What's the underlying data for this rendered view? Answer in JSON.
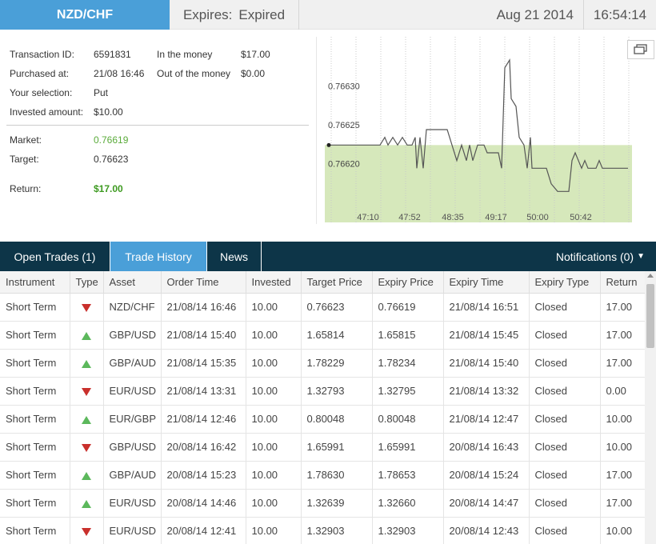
{
  "header": {
    "asset": "NZD/CHF",
    "expires_label": "Expires:",
    "expires_value": "Expired",
    "date": "Aug 21 2014",
    "time": "16:54:14"
  },
  "info": {
    "transaction_id_label": "Transaction ID:",
    "transaction_id": "6591831",
    "purchased_label": "Purchased at:",
    "purchased": "21/08 16:46",
    "selection_label": "Your selection:",
    "selection": "Put",
    "invested_label": "Invested amount:",
    "invested": "$10.00",
    "in_money_label": "In the money",
    "in_money": "$17.00",
    "out_money_label": "Out of the money",
    "out_money": "$0.00",
    "market_label": "Market:",
    "market": "0.76619",
    "target_label": "Target:",
    "target": "0.76623",
    "return_label": "Return:",
    "return": "$17.00"
  },
  "chart_data": {
    "type": "line",
    "y_tick_labels": [
      "0.76630",
      "0.76625",
      "0.76620"
    ],
    "x_tick_labels": [
      "47:10",
      "47:52",
      "48:35",
      "49:17",
      "50:00",
      "50:42"
    ],
    "target_level": 0.76623,
    "ylim": [
      0.76613,
      0.76637
    ],
    "highlight_color": "#d6e8bb",
    "line_color": "#555555",
    "points": [
      [
        0,
        0.76623
      ],
      [
        64,
        0.76623
      ],
      [
        70,
        0.76624
      ],
      [
        74,
        0.76623
      ],
      [
        80,
        0.76624
      ],
      [
        86,
        0.76623
      ],
      [
        92,
        0.76624
      ],
      [
        98,
        0.76623
      ],
      [
        104,
        0.76623
      ],
      [
        108,
        0.76624
      ],
      [
        110,
        0.7662
      ],
      [
        114,
        0.76624
      ],
      [
        118,
        0.7662
      ],
      [
        122,
        0.76625
      ],
      [
        148,
        0.76625
      ],
      [
        154,
        0.76623
      ],
      [
        160,
        0.76621
      ],
      [
        166,
        0.76623
      ],
      [
        172,
        0.76621
      ],
      [
        176,
        0.76623
      ],
      [
        180,
        0.76621
      ],
      [
        186,
        0.76623
      ],
      [
        194,
        0.76623
      ],
      [
        198,
        0.76622
      ],
      [
        212,
        0.76622
      ],
      [
        216,
        0.7662
      ],
      [
        220,
        0.76633
      ],
      [
        226,
        0.76634
      ],
      [
        228,
        0.76629
      ],
      [
        234,
        0.76628
      ],
      [
        238,
        0.76624
      ],
      [
        244,
        0.76623
      ],
      [
        248,
        0.7662
      ],
      [
        252,
        0.76624
      ],
      [
        254,
        0.7662
      ],
      [
        272,
        0.7662
      ],
      [
        278,
        0.76618
      ],
      [
        286,
        0.76617
      ],
      [
        300,
        0.76617
      ],
      [
        304,
        0.76621
      ],
      [
        308,
        0.76622
      ],
      [
        312,
        0.76621
      ],
      [
        316,
        0.7662
      ],
      [
        320,
        0.76621
      ],
      [
        324,
        0.7662
      ],
      [
        334,
        0.7662
      ],
      [
        338,
        0.76621
      ],
      [
        342,
        0.7662
      ],
      [
        358,
        0.7662
      ],
      [
        362,
        0.7662
      ],
      [
        374,
        0.7662
      ]
    ]
  },
  "tabs": {
    "open_trades": "Open Trades (1)",
    "trade_history": "Trade History",
    "news": "News",
    "notifications": "Notifications (0)"
  },
  "table": {
    "headers": [
      "Instrument",
      "Type",
      "Asset",
      "Order Time",
      "Invested",
      "Target Price",
      "Expiry Price",
      "Expiry Time",
      "Expiry Type",
      "Return"
    ],
    "rows": [
      {
        "instrument": "Short Term",
        "type": "down",
        "asset": "NZD/CHF",
        "order_time": "21/08/14 16:46",
        "invested": "10.00",
        "target": "0.76623",
        "expiry_price": "0.76619",
        "expiry_time": "21/08/14 16:51",
        "expiry_type": "Closed",
        "return": "17.00"
      },
      {
        "instrument": "Short Term",
        "type": "up",
        "asset": "GBP/USD",
        "order_time": "21/08/14 15:40",
        "invested": "10.00",
        "target": "1.65814",
        "expiry_price": "1.65815",
        "expiry_time": "21/08/14 15:45",
        "expiry_type": "Closed",
        "return": "17.00"
      },
      {
        "instrument": "Short Term",
        "type": "up",
        "asset": "GBP/AUD",
        "order_time": "21/08/14 15:35",
        "invested": "10.00",
        "target": "1.78229",
        "expiry_price": "1.78234",
        "expiry_time": "21/08/14 15:40",
        "expiry_type": "Closed",
        "return": "17.00"
      },
      {
        "instrument": "Short Term",
        "type": "down",
        "asset": "EUR/USD",
        "order_time": "21/08/14 13:31",
        "invested": "10.00",
        "target": "1.32793",
        "expiry_price": "1.32795",
        "expiry_time": "21/08/14 13:32",
        "expiry_type": "Closed",
        "return": "0.00"
      },
      {
        "instrument": "Short Term",
        "type": "up",
        "asset": "EUR/GBP",
        "order_time": "21/08/14 12:46",
        "invested": "10.00",
        "target": "0.80048",
        "expiry_price": "0.80048",
        "expiry_time": "21/08/14 12:47",
        "expiry_type": "Closed",
        "return": "10.00"
      },
      {
        "instrument": "Short Term",
        "type": "down",
        "asset": "GBP/USD",
        "order_time": "20/08/14 16:42",
        "invested": "10.00",
        "target": "1.65991",
        "expiry_price": "1.65991",
        "expiry_time": "20/08/14 16:43",
        "expiry_type": "Closed",
        "return": "10.00"
      },
      {
        "instrument": "Short Term",
        "type": "up",
        "asset": "GBP/AUD",
        "order_time": "20/08/14 15:23",
        "invested": "10.00",
        "target": "1.78630",
        "expiry_price": "1.78653",
        "expiry_time": "20/08/14 15:24",
        "expiry_type": "Closed",
        "return": "17.00"
      },
      {
        "instrument": "Short Term",
        "type": "up",
        "asset": "EUR/USD",
        "order_time": "20/08/14 14:46",
        "invested": "10.00",
        "target": "1.32639",
        "expiry_price": "1.32660",
        "expiry_time": "20/08/14 14:47",
        "expiry_type": "Closed",
        "return": "17.00"
      },
      {
        "instrument": "Short Term",
        "type": "down",
        "asset": "EUR/USD",
        "order_time": "20/08/14 12:41",
        "invested": "10.00",
        "target": "1.32903",
        "expiry_price": "1.32903",
        "expiry_time": "20/08/14 12:43",
        "expiry_type": "Closed",
        "return": "10.00"
      }
    ]
  }
}
